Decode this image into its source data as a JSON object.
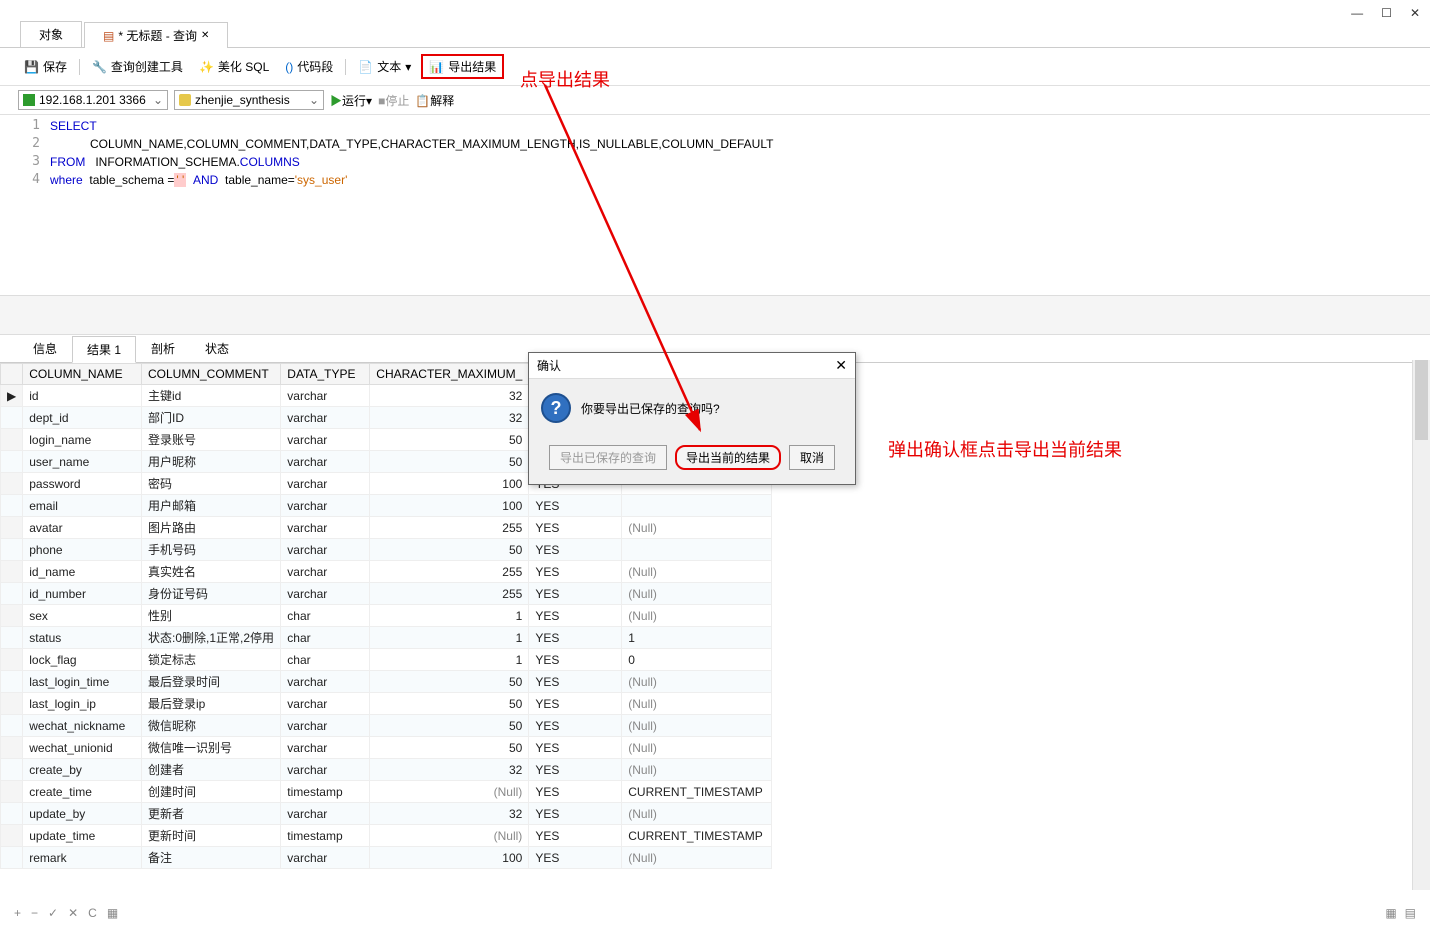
{
  "window": {
    "min": "—",
    "max": "☐",
    "close": "✕"
  },
  "tabs": {
    "t1": "对象",
    "t2": "* 无标题 - 查询"
  },
  "toolbar": {
    "save": "保存",
    "querybuild": "查询创建工具",
    "beautify": "美化 SQL",
    "codesnip": "代码段",
    "text": "文本",
    "export": "导出结果"
  },
  "connbar": {
    "server": "192.168.1.201 3366",
    "db": "zhenjie_synthesis",
    "run": "运行",
    "stop": "停止",
    "explain": "解释"
  },
  "sql": {
    "l1a": "SELECT",
    "l2": "COLUMN_NAME,COLUMN_COMMENT,DATA_TYPE,CHARACTER_MAXIMUM_LENGTH,IS_NULLABLE,COLUMN_DEFAULT",
    "l3a": "FROM",
    "l3b": "INFORMATION_SCHEMA.",
    "l3c": "COLUMNS",
    "l4a": "where",
    "l4b": "table_schema =",
    "l4c": "'                       '",
    "l4d": "AND",
    "l4e": "table_name=",
    "l4f": "'sys_user'"
  },
  "rtabs": {
    "info": "信息",
    "result": "结果 1",
    "analyze": "剖析",
    "status": "状态"
  },
  "cols": {
    "c1": "COLUMN_NAME",
    "c2": "COLUMN_COMMENT",
    "c3": "DATA_TYPE",
    "c4": "CHARACTER_MAXIMUM_",
    "c5": "",
    "c6": ""
  },
  "rows": [
    {
      "c1": "id",
      "c2": "主键id",
      "c3": "varchar",
      "c4": "32",
      "c5": "",
      "c6": ""
    },
    {
      "c1": "dept_id",
      "c2": "部门ID",
      "c3": "varchar",
      "c4": "32",
      "c5": "",
      "c6": ""
    },
    {
      "c1": "login_name",
      "c2": "登录账号",
      "c3": "varchar",
      "c4": "50",
      "c5": "",
      "c6": ""
    },
    {
      "c1": "user_name",
      "c2": "用户昵称",
      "c3": "varchar",
      "c4": "50",
      "c5": "",
      "c6": ""
    },
    {
      "c1": "password",
      "c2": "密码",
      "c3": "varchar",
      "c4": "100",
      "c5": "YES",
      "c6": ""
    },
    {
      "c1": "email",
      "c2": "用户邮箱",
      "c3": "varchar",
      "c4": "100",
      "c5": "YES",
      "c6": ""
    },
    {
      "c1": "avatar",
      "c2": "图片路由",
      "c3": "varchar",
      "c4": "255",
      "c5": "YES",
      "c6": "(Null)"
    },
    {
      "c1": "phone",
      "c2": "手机号码",
      "c3": "varchar",
      "c4": "50",
      "c5": "YES",
      "c6": ""
    },
    {
      "c1": "id_name",
      "c2": "真实姓名",
      "c3": "varchar",
      "c4": "255",
      "c5": "YES",
      "c6": "(Null)"
    },
    {
      "c1": "id_number",
      "c2": "身份证号码",
      "c3": "varchar",
      "c4": "255",
      "c5": "YES",
      "c6": "(Null)"
    },
    {
      "c1": "sex",
      "c2": "性别",
      "c3": "char",
      "c4": "1",
      "c5": "YES",
      "c6": "(Null)"
    },
    {
      "c1": "status",
      "c2": "状态:0删除,1正常,2停用",
      "c3": "char",
      "c4": "1",
      "c5": "YES",
      "c6": "1"
    },
    {
      "c1": "lock_flag",
      "c2": "锁定标志",
      "c3": "char",
      "c4": "1",
      "c5": "YES",
      "c6": "0"
    },
    {
      "c1": "last_login_time",
      "c2": "最后登录时间",
      "c3": "varchar",
      "c4": "50",
      "c5": "YES",
      "c6": "(Null)"
    },
    {
      "c1": "last_login_ip",
      "c2": "最后登录ip",
      "c3": "varchar",
      "c4": "50",
      "c5": "YES",
      "c6": "(Null)"
    },
    {
      "c1": "wechat_nickname",
      "c2": "微信昵称",
      "c3": "varchar",
      "c4": "50",
      "c5": "YES",
      "c6": "(Null)"
    },
    {
      "c1": "wechat_unionid",
      "c2": "微信唯一识别号",
      "c3": "varchar",
      "c4": "50",
      "c5": "YES",
      "c6": "(Null)"
    },
    {
      "c1": "create_by",
      "c2": "创建者",
      "c3": "varchar",
      "c4": "32",
      "c5": "YES",
      "c6": "(Null)"
    },
    {
      "c1": "create_time",
      "c2": "创建时间",
      "c3": "timestamp",
      "c4": "(Null)",
      "c5": "YES",
      "c6": "CURRENT_TIMESTAMP"
    },
    {
      "c1": "update_by",
      "c2": "更新者",
      "c3": "varchar",
      "c4": "32",
      "c5": "YES",
      "c6": "(Null)"
    },
    {
      "c1": "update_time",
      "c2": "更新时间",
      "c3": "timestamp",
      "c4": "(Null)",
      "c5": "YES",
      "c6": "CURRENT_TIMESTAMP"
    },
    {
      "c1": "remark",
      "c2": "备注",
      "c3": "varchar",
      "c4": "100",
      "c5": "YES",
      "c6": "(Null)"
    }
  ],
  "dialog": {
    "title": "确认",
    "msg": "你要导出已保存的查询吗?",
    "btn1": "导出已保存的查询",
    "btn2": "导出当前的结果",
    "btn3": "取消"
  },
  "annot": {
    "a1": "点导出结果",
    "a2": "弹出确认框点击导出当前结果"
  },
  "footer": {
    "plus": "+",
    "minus": "−",
    "check": "✓",
    "x": "✕",
    "refresh": "C",
    "grid": "▦"
  }
}
